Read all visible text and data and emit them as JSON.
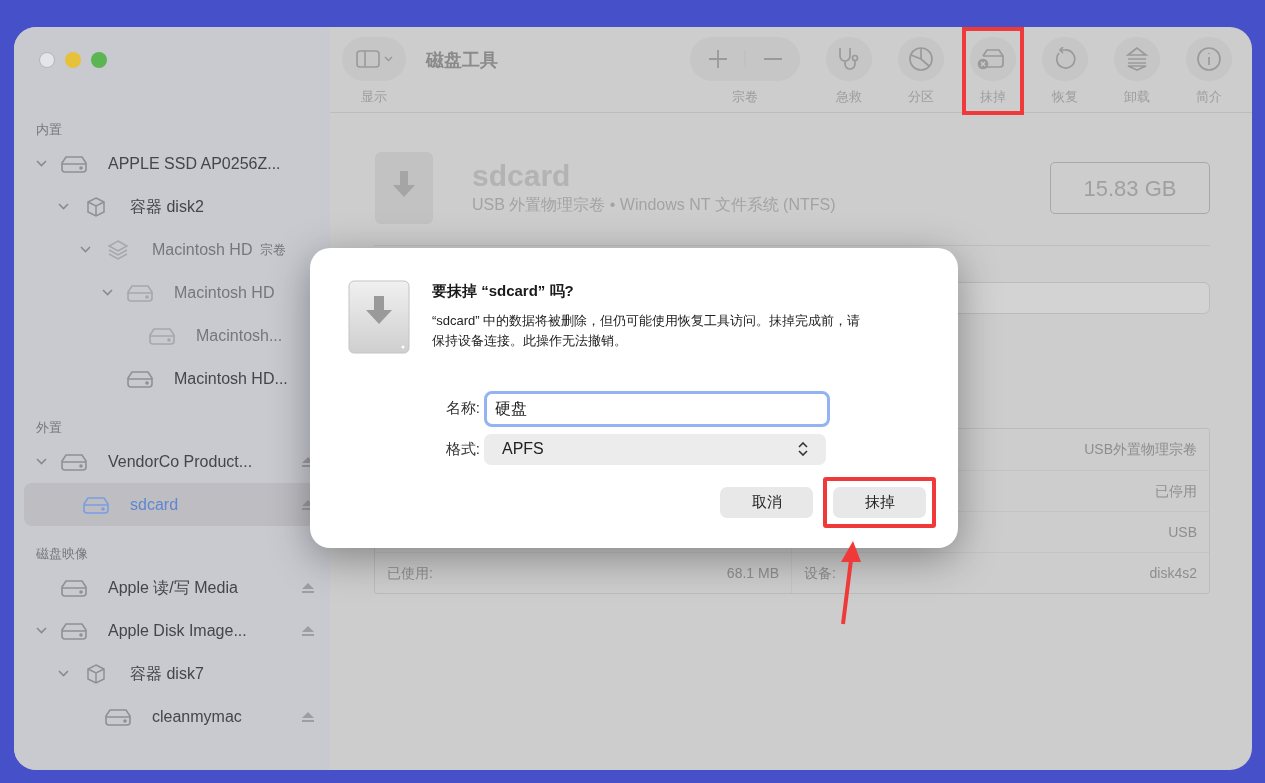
{
  "window": {
    "title": "磁盘工具",
    "sidebar_toggle_label": "显示"
  },
  "toolbar": [
    {
      "kind": "add-remove",
      "label": "宗卷",
      "highlighted": false
    },
    {
      "kind": "stethoscope",
      "label": "急救",
      "highlighted": false
    },
    {
      "kind": "pie",
      "label": "分区",
      "highlighted": false
    },
    {
      "kind": "erase",
      "label": "抹掉",
      "highlighted": true
    },
    {
      "kind": "restore",
      "label": "恢复",
      "highlighted": false
    },
    {
      "kind": "unmount",
      "label": "卸载",
      "highlighted": false
    },
    {
      "kind": "info",
      "label": "简介",
      "highlighted": false
    }
  ],
  "sidebar": {
    "sections": [
      {
        "title": "内置",
        "items": [
          {
            "label": "APPLE SSD AP0256Z...",
            "kind": "drive",
            "expanded": true,
            "dimmed": false,
            "selected": false,
            "ejectable": false,
            "children": [
              {
                "label": "容器 disk2",
                "kind": "container",
                "expanded": true,
                "dimmed": false,
                "selected": false,
                "ejectable": false,
                "children": [
                  {
                    "label": "Macintosh HD",
                    "suffix": "宗卷",
                    "kind": "layers",
                    "expanded": true,
                    "dimmed": true,
                    "selected": false,
                    "ejectable": false,
                    "children": [
                      {
                        "label": "Macintosh HD",
                        "kind": "drive",
                        "expanded": true,
                        "dimmed": true,
                        "selected": false,
                        "ejectable": false,
                        "children": [
                          {
                            "label": "Macintosh...",
                            "kind": "drive",
                            "expanded": false,
                            "dimmed": true,
                            "selected": false,
                            "ejectable": false
                          }
                        ]
                      },
                      {
                        "label": "Macintosh HD...",
                        "kind": "drive",
                        "expanded": false,
                        "dimmed": false,
                        "selected": false,
                        "ejectable": false
                      }
                    ]
                  }
                ]
              }
            ]
          }
        ]
      },
      {
        "title": "外置",
        "items": [
          {
            "label": "VendorCo Product...",
            "kind": "drive",
            "expanded": true,
            "dimmed": false,
            "selected": false,
            "ejectable": true,
            "children": [
              {
                "label": "sdcard",
                "kind": "drive",
                "expanded": false,
                "dimmed": false,
                "selected": true,
                "ejectable": true
              }
            ]
          }
        ]
      },
      {
        "title": "磁盘映像",
        "items": [
          {
            "label": "Apple 读/写 Media",
            "kind": "drive",
            "expanded": false,
            "dimmed": false,
            "selected": false,
            "ejectable": true
          },
          {
            "label": "Apple Disk Image...",
            "kind": "drive",
            "expanded": true,
            "dimmed": false,
            "selected": false,
            "ejectable": true,
            "children": [
              {
                "label": "容器 disk7",
                "kind": "container",
                "expanded": true,
                "dimmed": false,
                "selected": false,
                "ejectable": false,
                "children": [
                  {
                    "label": "cleanmymac",
                    "kind": "drive",
                    "expanded": false,
                    "dimmed": false,
                    "selected": false,
                    "ejectable": true
                  }
                ]
              }
            ]
          }
        ]
      }
    ]
  },
  "volume": {
    "name": "sdcard",
    "description": "USB 外置物理宗卷 • Windows NT 文件系统 (NTFS)",
    "capacity": "15.83 GB"
  },
  "info_table": [
    {
      "right_value": "USB外置物理宗卷"
    },
    {
      "right_value": "已停用"
    },
    {
      "right_value": "USB"
    },
    {
      "left_label": "已使用:",
      "left_value": "68.1 MB",
      "right_label": "设备:",
      "right_value": "disk4s2"
    }
  ],
  "dialog": {
    "title": "要抹掉 “sdcard” 吗?",
    "message": "“sdcard” 中的数据将被删除，但仍可能使用恢复工具访问。抹掉完成前，请保持设备连接。此操作无法撤销。",
    "name_label": "名称:",
    "name_value": "硬盘",
    "format_label": "格式:",
    "format_value": "APFS",
    "buttons": [
      {
        "label": "取消",
        "highlighted": false
      },
      {
        "label": "抹掉",
        "highlighted": true
      }
    ]
  },
  "annotation_arrow": true
}
